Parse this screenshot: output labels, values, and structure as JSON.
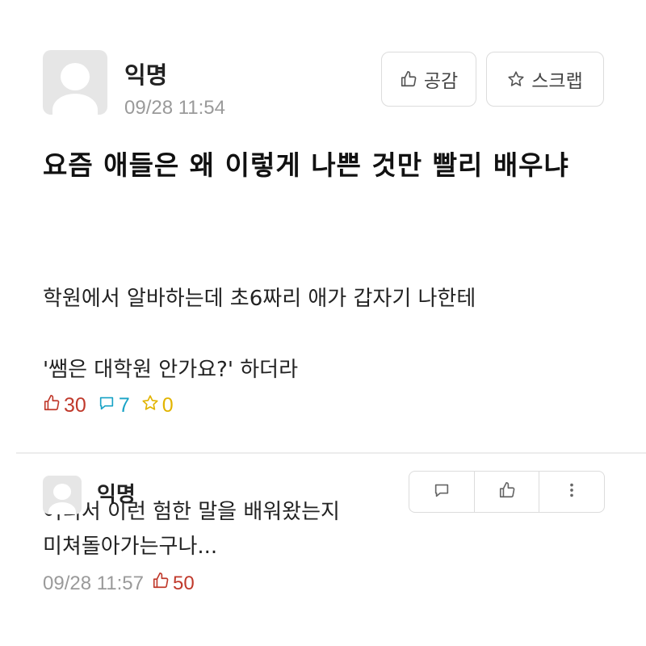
{
  "post": {
    "author": "익명",
    "timestamp": "09/28 11:54",
    "like_button_label": "공감",
    "scrap_button_label": "스크랩",
    "title": "요즘 애들은 왜 이렇게 나쁜 것만 빨리 배우냐",
    "content_line1": "학원에서 알바하는데 초6짜리 애가 갑자기 나한테",
    "content_line2": "'쌤은 대학원 안가요?' 하더라",
    "content_line3": "어디서 이런 험한 말을 배워왔는지",
    "like_count": "30",
    "comment_count": "7",
    "scrap_count": "0"
  },
  "comment": {
    "author": "익명",
    "text": "미쳐돌아가는구나...",
    "timestamp": "09/28 11:57",
    "like_count": "50"
  },
  "icons": {
    "like": "thumbs-up-icon",
    "scrap": "star-icon",
    "comment": "speech-bubble-icon",
    "more": "more-vertical-icon"
  },
  "colors": {
    "like": "#c0392b",
    "comment": "#19a3c6",
    "scrap": "#e2b400",
    "timestamp": "#9a9a9a"
  }
}
